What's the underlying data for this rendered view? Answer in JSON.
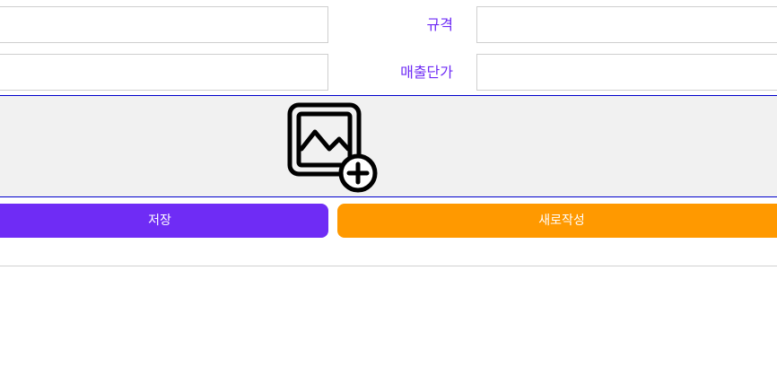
{
  "form": {
    "fields": [
      {
        "label": "규격",
        "value": ""
      },
      {
        "label": "매출단가",
        "value": ""
      }
    ],
    "left_inputs": [
      {
        "value": ""
      },
      {
        "value": ""
      }
    ],
    "label_color": "#6f2cf5"
  },
  "image_panel": {
    "icon": "image-add-icon"
  },
  "actions": {
    "save_label": "저장",
    "new_label": "새로작성",
    "save_color": "#6f2cf5",
    "new_color": "#ff9900"
  }
}
